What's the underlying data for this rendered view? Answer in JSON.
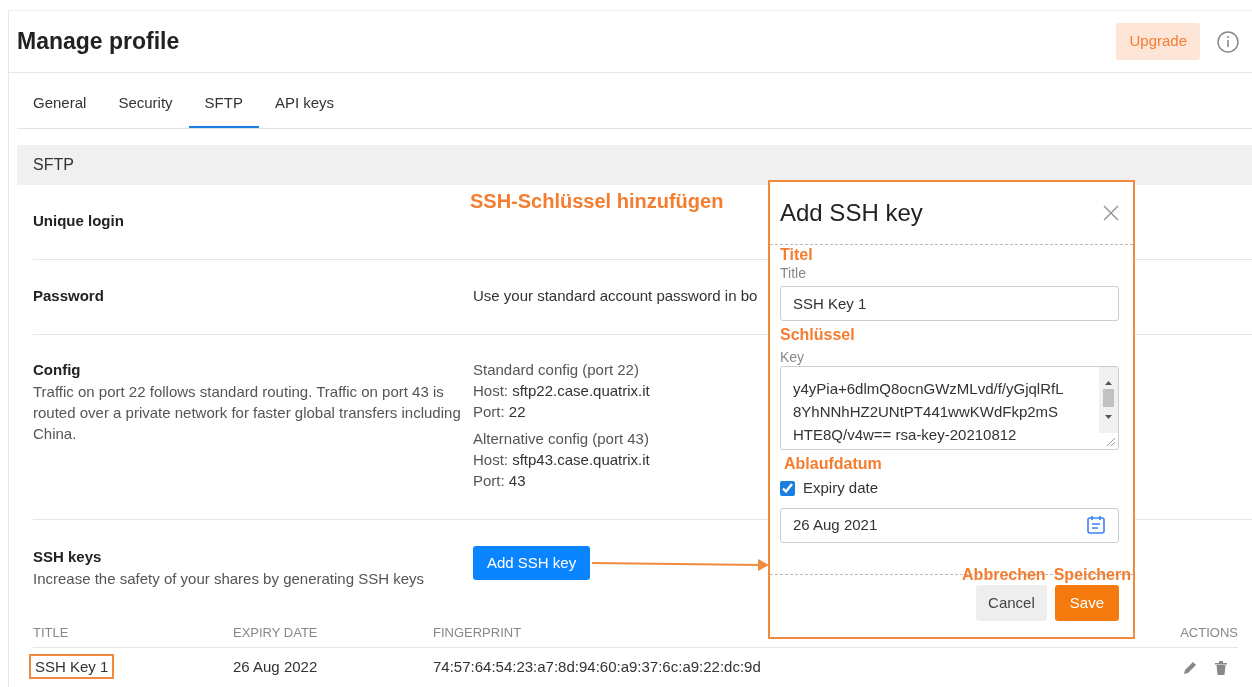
{
  "header": {
    "title": "Manage profile",
    "upgrade_button": "Upgrade"
  },
  "tabs": [
    {
      "label": "General",
      "selected": false
    },
    {
      "label": "Security",
      "selected": false
    },
    {
      "label": "SFTP",
      "selected": true
    },
    {
      "label": "API keys",
      "selected": false
    }
  ],
  "section_title": "SFTP",
  "settings": [
    {
      "kind": "plain",
      "label": "Unique login"
    },
    {
      "kind": "text",
      "label": "Password",
      "value": "Use your standard account password in bo"
    },
    {
      "kind": "config",
      "label": "Config",
      "description": "Traffic on port 22 follows standard routing. Traffic on port 43 is routed over a private network for faster global transfers including China.",
      "configs": [
        {
          "title": "Standard config (port 22)",
          "host_label": "Host:",
          "host": "sftp22.case.quatrix.it",
          "port_label": "Port:",
          "port": "22"
        },
        {
          "title": "Alternative config (port 43)",
          "host_label": "Host:",
          "host": "sftp43.case.quatrix.it",
          "port_label": "Port:",
          "port": "43"
        }
      ]
    },
    {
      "kind": "action",
      "label": "SSH keys",
      "description": "Increase the safety of your shares by generating SSH keys",
      "button": "Add SSH key"
    }
  ],
  "table": {
    "columns": [
      "TITLE",
      "EXPIRY DATE",
      "FINGERPRINT",
      "ACTIONS"
    ],
    "rows": [
      {
        "title": "SSH Key 1",
        "expiry": "26 Aug 2022",
        "fingerprint": "74:57:64:54:23:a7:8d:94:60:a9:37:6c:a9:22:dc:9d",
        "highlighted": true
      }
    ]
  },
  "dialog": {
    "title": "Add SSH key",
    "title_field": {
      "annotation": "Titel",
      "label": "Title",
      "value": "SSH Key 1"
    },
    "key_field": {
      "annotation": "Schlüssel",
      "label": "Key",
      "lines": [
        "y4yPia+6dlmQ8ocnGWzMLvd/f/yGjqlRfL",
        "8YhNNhHZ2UNtPT441wwKWdFkp2mS",
        "HTE8Q/v4w== rsa-key-20210812"
      ]
    },
    "expiry": {
      "annotation": "Ablaufdatum",
      "label": "Expiry date",
      "checked": true,
      "value": "26 Aug 2021"
    },
    "footer_annotations": [
      "Abbrechen",
      "Speichern"
    ],
    "buttons": [
      {
        "kind": "secondary",
        "label": "Cancel"
      },
      {
        "kind": "primary",
        "label": "Save"
      }
    ]
  },
  "annotation": "SSH-Schlüssel hinzufügen"
}
